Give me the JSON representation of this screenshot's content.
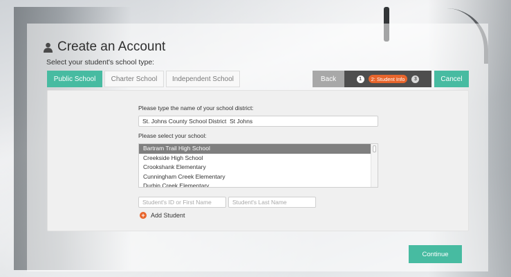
{
  "header": {
    "title": "Create an Account",
    "icon": "user-icon",
    "subtitle": "Select your student's school type:"
  },
  "school_types": [
    {
      "label": "Public School",
      "active": true
    },
    {
      "label": "Charter School",
      "active": false
    },
    {
      "label": "Independent School",
      "active": false
    }
  ],
  "nav": {
    "back_label": "Back",
    "cancel_label": "Cancel",
    "steps": [
      "1",
      "2: Student Info",
      "3"
    ],
    "current_step": 2
  },
  "form": {
    "district_label": "Please type the name of your school district:",
    "district_value": "St. Johns County School District  St Johns",
    "school_label": "Please select your school:",
    "schools": [
      "Bartram Trail High School",
      "Creekside High School",
      "Crookshank Elementary",
      "Cunningham Creek Elementary",
      "Durbin Creek Elementary"
    ],
    "selected_school": "Bartram Trail High School",
    "student_id_placeholder": "Student's ID or First Name",
    "student_last_placeholder": "Student's Last Name",
    "add_student_label": "Add Student"
  },
  "footer": {
    "continue_label": "Continue"
  },
  "colors": {
    "accent": "#47bba1",
    "orange": "#e8652c",
    "dark_step_bar": "#4e4e4e",
    "back_button": "#a8a8a8",
    "selected_row": "#7f7f7f"
  }
}
